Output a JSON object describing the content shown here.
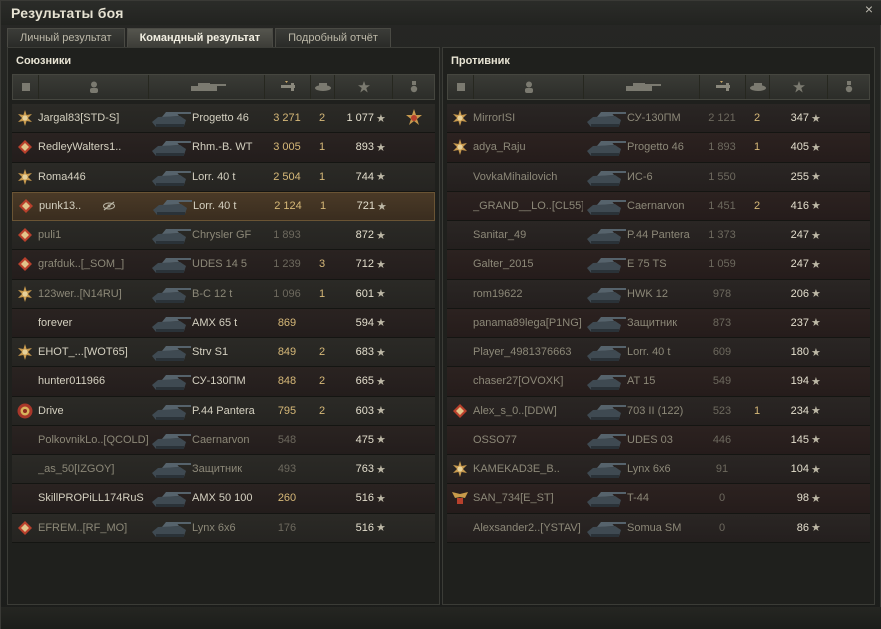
{
  "window": {
    "title": "Результаты боя",
    "close_symbol": "×"
  },
  "tabs": [
    {
      "label": "Личный результат"
    },
    {
      "label": "Командный результат"
    },
    {
      "label": "Подробный отчёт"
    }
  ],
  "allies": {
    "title": "Союзники",
    "rows": [
      {
        "name": "Jargal83[STD-S]",
        "tank": "Progetto 46",
        "damage": "3 271",
        "kills": "2",
        "xp": "1 077",
        "badge": "star",
        "medal": true
      },
      {
        "name": "RedleyWalters1..",
        "tank": "Rhm.-B. WT",
        "damage": "3 005",
        "kills": "1",
        "xp": "893",
        "badge": "diamond"
      },
      {
        "name": "Roma446",
        "tank": "Lorr. 40 t",
        "damage": "2 504",
        "kills": "1",
        "xp": "744",
        "badge": "star"
      },
      {
        "name": "punk13..",
        "tank": "Lorr. 40 t",
        "damage": "2 124",
        "kills": "1",
        "xp": "721",
        "badge": "diamond",
        "highlight": true,
        "hidden_icon": true
      },
      {
        "name": "puli1",
        "tank": "Chrysler GF",
        "damage": "1 893",
        "kills": "",
        "xp": "872",
        "badge": "diamond",
        "dead": true
      },
      {
        "name": "grafduk..[_SOM_]",
        "tank": "UDES 14 5",
        "damage": "1 239",
        "kills": "3",
        "xp": "712",
        "badge": "diamond",
        "dead": true
      },
      {
        "name": "123wer..[N14RU]",
        "tank": "B-C 12 t",
        "damage": "1 096",
        "kills": "1",
        "xp": "601",
        "badge": "star",
        "dead": true
      },
      {
        "name": "forever",
        "tank": "AMX 65 t",
        "damage": "869",
        "kills": "",
        "xp": "594",
        "badge": ""
      },
      {
        "name": "EHOT_...[WOT65]",
        "tank": "Strv S1",
        "damage": "849",
        "kills": "2",
        "xp": "683",
        "badge": "star"
      },
      {
        "name": "hunter011966",
        "tank": "СУ-130ПМ",
        "damage": "848",
        "kills": "2",
        "xp": "665",
        "badge": ""
      },
      {
        "name": "Drive",
        "tank": "P.44 Pantera",
        "damage": "795",
        "kills": "2",
        "xp": "603",
        "badge": "round"
      },
      {
        "name": "PolkovnikLo..[QCOLD]",
        "tank": "Caernarvon",
        "damage": "548",
        "kills": "",
        "xp": "475",
        "badge": "",
        "dead": true
      },
      {
        "name": "_as_50[IZGOY]",
        "tank": "Защитник",
        "damage": "493",
        "kills": "",
        "xp": "763",
        "badge": "",
        "dead": true
      },
      {
        "name": "SkillPROPiLL174RuS",
        "tank": "AMX 50 100",
        "damage": "260",
        "kills": "",
        "xp": "516",
        "badge": ""
      },
      {
        "name": "EFREM..[RF_MO]",
        "tank": "Lynx 6x6",
        "damage": "176",
        "kills": "",
        "xp": "516",
        "badge": "diamond",
        "dead": true
      }
    ]
  },
  "enemies": {
    "title": "Противник",
    "rows": [
      {
        "name": "MirrorISI",
        "tank": "СУ-130ПМ",
        "damage": "2 121",
        "kills": "2",
        "xp": "347",
        "badge": "star",
        "dead": true
      },
      {
        "name": "adya_Raju",
        "tank": "Progetto 46",
        "damage": "1 893",
        "kills": "1",
        "xp": "405",
        "badge": "star",
        "dead": true
      },
      {
        "name": "VovkaMihailovich",
        "tank": "ИС-6",
        "damage": "1 550",
        "kills": "",
        "xp": "255",
        "badge": "",
        "dead": true
      },
      {
        "name": "_GRAND__LO..[CL55]",
        "tank": "Caernarvon",
        "damage": "1 451",
        "kills": "2",
        "xp": "416",
        "badge": "",
        "dead": true
      },
      {
        "name": "Sanitar_49",
        "tank": "P.44 Pantera",
        "damage": "1 373",
        "kills": "",
        "xp": "247",
        "badge": "",
        "dead": true
      },
      {
        "name": "Galter_2015",
        "tank": "E 75 TS",
        "damage": "1 059",
        "kills": "",
        "xp": "247",
        "badge": "",
        "dead": true
      },
      {
        "name": "rom19622",
        "tank": "HWK 12",
        "damage": "978",
        "kills": "",
        "xp": "206",
        "badge": "",
        "dead": true
      },
      {
        "name": "panama89lega[P1NG]",
        "tank": "Защитник",
        "damage": "873",
        "kills": "",
        "xp": "237",
        "badge": "",
        "dead": true
      },
      {
        "name": "Player_4981376663",
        "tank": "Lorr. 40 t",
        "damage": "609",
        "kills": "",
        "xp": "180",
        "badge": "",
        "dead": true
      },
      {
        "name": "chaser27[OVOXK]",
        "tank": "AT 15",
        "damage": "549",
        "kills": "",
        "xp": "194",
        "badge": "",
        "dead": true
      },
      {
        "name": "Alex_s_0..[DDW]",
        "tank": "703 II (122)",
        "damage": "523",
        "kills": "1",
        "xp": "234",
        "badge": "diamond",
        "dead": true
      },
      {
        "name": "OSSO77",
        "tank": "UDES 03",
        "damage": "446",
        "kills": "",
        "xp": "145",
        "badge": "",
        "dead": true
      },
      {
        "name": "KAMEKAD3E_B..",
        "tank": "Lynx 6x6",
        "damage": "91",
        "kills": "",
        "xp": "104",
        "badge": "star",
        "dead": true
      },
      {
        "name": "SAN_734[E_ST]",
        "tank": "T-44",
        "damage": "0",
        "kills": "",
        "xp": "98",
        "badge": "wings",
        "dead": true
      },
      {
        "name": "Alexsander2..[YSTAV]",
        "tank": "Somua SM",
        "damage": "0",
        "kills": "",
        "xp": "86",
        "badge": "",
        "dead": true
      }
    ]
  },
  "xp_star": "★",
  "colors": {
    "accent": "#d6b878",
    "text": "#d4d0c0",
    "dead_text": "#8c8878"
  }
}
